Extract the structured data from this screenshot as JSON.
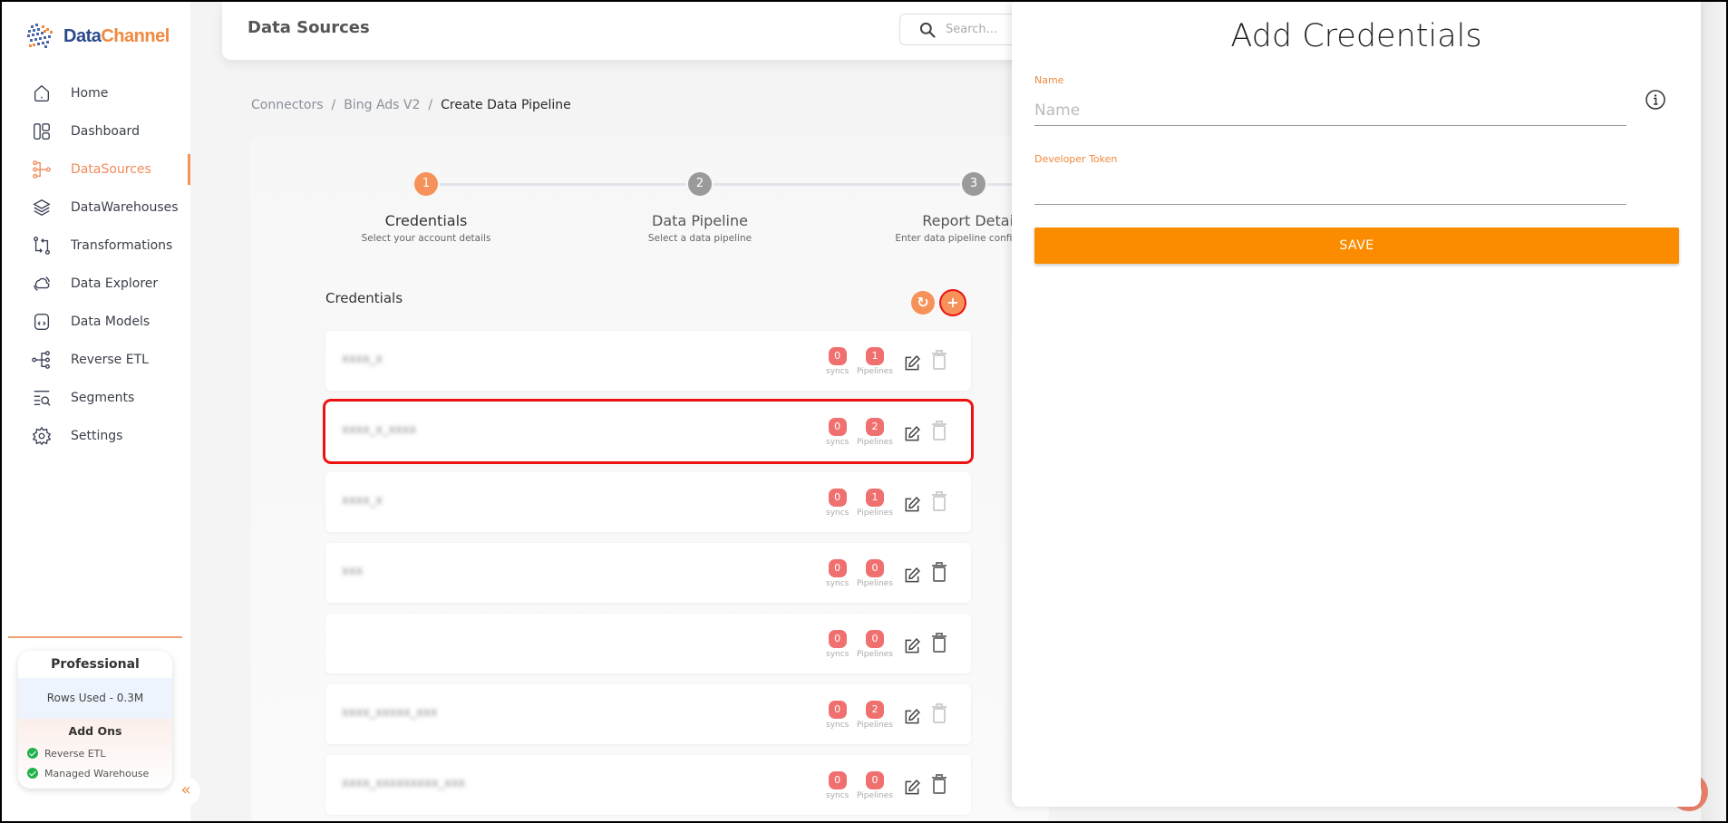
{
  "brand": {
    "part1": "Data",
    "part2": "Channel"
  },
  "sidebar": {
    "items": [
      {
        "label": "Home",
        "icon": "home-icon",
        "active": false
      },
      {
        "label": "Dashboard",
        "icon": "dashboard-icon",
        "active": false
      },
      {
        "label": "DataSources",
        "icon": "datasources-icon",
        "active": true
      },
      {
        "label": "DataWarehouses",
        "icon": "layers-icon",
        "active": false
      },
      {
        "label": "Transformations",
        "icon": "transform-icon",
        "active": false
      },
      {
        "label": "Data Explorer",
        "icon": "explorer-icon",
        "active": false
      },
      {
        "label": "Data Models",
        "icon": "code-box-icon",
        "active": false
      },
      {
        "label": "Reverse ETL",
        "icon": "reverse-etl-icon",
        "active": false
      },
      {
        "label": "Segments",
        "icon": "segments-icon",
        "active": false
      },
      {
        "label": "Settings",
        "icon": "gear-icon",
        "active": false
      }
    ],
    "plan": {
      "title": "Professional",
      "rows_used": "Rows Used - 0.3M",
      "addons_title": "Add Ons",
      "addons": [
        "Reverse ETL",
        "Managed Warehouse"
      ]
    },
    "collapse_label": "«"
  },
  "header": {
    "title": "Data Sources",
    "search_placeholder": "Search..."
  },
  "breadcrumb": {
    "items": [
      "Connectors",
      "Bing Ads V2",
      "Create Data Pipeline"
    ],
    "separator": "/"
  },
  "stepper": {
    "steps": [
      {
        "number": "1",
        "title": "Credentials",
        "subtitle": "Select your account details",
        "active": true
      },
      {
        "number": "2",
        "title": "Data Pipeline",
        "subtitle": "Select a data pipeline",
        "active": false
      },
      {
        "number": "3",
        "title": "Report Details",
        "subtitle": "Enter data pipeline configuration",
        "active": false
      }
    ]
  },
  "credentials": {
    "heading": "Credentials",
    "refresh_label": "↻",
    "add_label": "+",
    "syncs_label": "syncs",
    "pipelines_label": "Pipelines",
    "rows": [
      {
        "name": "xxxx_x",
        "syncs": "0",
        "pipelines": "1",
        "highlighted": false
      },
      {
        "name": "xxxx_x_xxxx",
        "syncs": "0",
        "pipelines": "2",
        "highlighted": true
      },
      {
        "name": "xxxx_x",
        "syncs": "0",
        "pipelines": "1",
        "highlighted": false
      },
      {
        "name": "xxx",
        "syncs": "0",
        "pipelines": "0",
        "highlighted": false
      },
      {
        "name": "",
        "syncs": "0",
        "pipelines": "0",
        "highlighted": false
      },
      {
        "name": "xxxx_xxxxx_xxx",
        "syncs": "0",
        "pipelines": "2",
        "highlighted": false
      },
      {
        "name": "xxxx_xxxxxxxxx_xxx",
        "syncs": "0",
        "pipelines": "0",
        "highlighted": false
      }
    ]
  },
  "panel": {
    "title": "Add Credentials",
    "fields": [
      {
        "label": "Name",
        "placeholder": "Name",
        "value": ""
      },
      {
        "label": "Developer Token",
        "placeholder": "",
        "value": ""
      }
    ],
    "save_label": "SAVE"
  },
  "colors": {
    "accent": "#f7915a",
    "save": "#fb8c00",
    "badge": "#f07070",
    "highlight": "#ee1111"
  }
}
